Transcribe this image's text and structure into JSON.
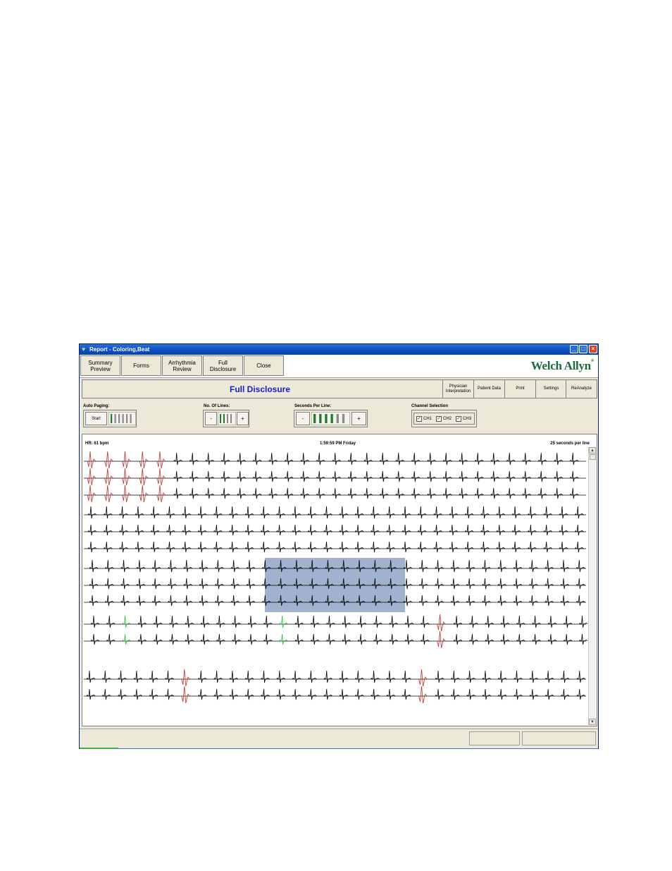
{
  "window": {
    "title": "Report - Coloring,Beat",
    "controls": {
      "minimize": "_",
      "maximize": "□",
      "close": "×"
    }
  },
  "toolbar": {
    "buttons": [
      {
        "line1": "Summary",
        "line2": "Preview"
      },
      {
        "line1": "Forms",
        "line2": ""
      },
      {
        "line1": "Arrhythmia",
        "line2": "Review"
      },
      {
        "line1": "Full",
        "line2": "Disclosure"
      },
      {
        "line1": "Close",
        "line2": ""
      }
    ],
    "logo": "Welch Allyn",
    "logo_mark": "®"
  },
  "header": {
    "title": "Full Disclosure",
    "buttons": [
      {
        "line1": "Physician",
        "line2": "Interpretation"
      },
      {
        "line1": "Patient Data",
        "line2": ""
      },
      {
        "line1": "Print",
        "line2": ""
      },
      {
        "line1": "Settings",
        "line2": ""
      },
      {
        "line1": "ReAnalyze",
        "line2": ""
      }
    ]
  },
  "controls": {
    "auto_paging": {
      "label": "Auto Paging:",
      "start": "Start",
      "level_bars": 6,
      "active_bars": 1
    },
    "num_lines": {
      "label": "No. Of Lines:",
      "minus": "-",
      "plus": "+",
      "level_bars": 4,
      "active_bars": 2
    },
    "seconds_per_line": {
      "label": "Seconds Per Line:",
      "minus": "-",
      "plus": "+",
      "level_bars": 6,
      "active_bars": 4
    },
    "channel_selection": {
      "label": "Channel Selection",
      "channels": [
        {
          "label": "CH1",
          "checked": true
        },
        {
          "label": "CH2",
          "checked": true
        },
        {
          "label": "CH3",
          "checked": true
        }
      ]
    }
  },
  "ecg": {
    "hr": "HR: 61 bpm",
    "time": "1:59:59 PM Friday",
    "scale": "25 seconds per line",
    "colors": {
      "normal": "#000000",
      "ventricular": "#c0302a",
      "paced": "#22c03a",
      "selection": "#8fa4c8"
    }
  },
  "scrollbar": {
    "up": "▲",
    "down": "▼"
  }
}
